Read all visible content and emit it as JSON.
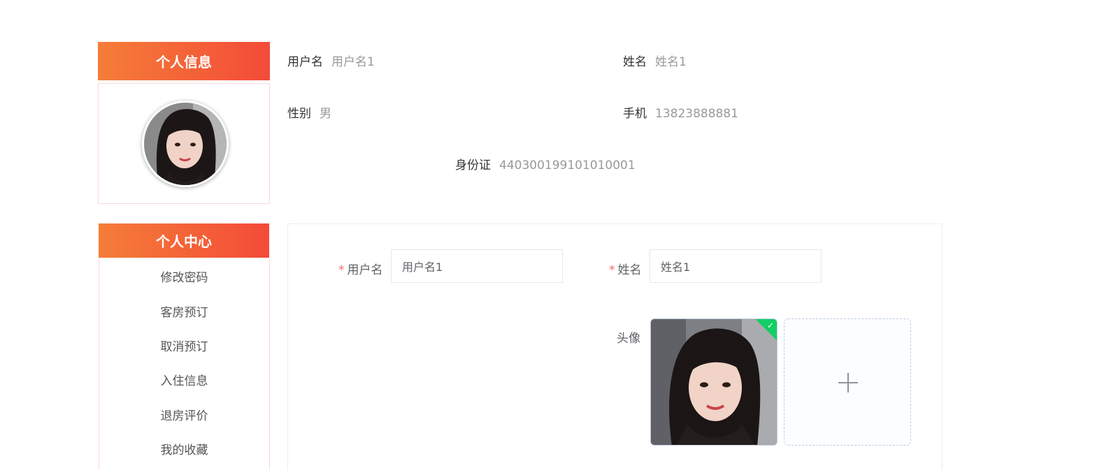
{
  "profile": {
    "header": "个人信息",
    "fields": {
      "username": {
        "label": "用户名",
        "value": "用户名1"
      },
      "name": {
        "label": "姓名",
        "value": "姓名1"
      },
      "gender": {
        "label": "性别",
        "value": "男"
      },
      "phone": {
        "label": "手机",
        "value": "13823888881"
      },
      "id_card": {
        "label": "身份证",
        "value": "440300199101010001"
      }
    }
  },
  "sidebar": {
    "header": "个人中心",
    "items": [
      {
        "label": "修改密码"
      },
      {
        "label": "客房预订"
      },
      {
        "label": "取消预订"
      },
      {
        "label": "入住信息"
      },
      {
        "label": "退房评价"
      },
      {
        "label": "我的收藏"
      }
    ]
  },
  "form": {
    "username": {
      "required_mark": "*",
      "label": "用户名",
      "value": "用户名1"
    },
    "name": {
      "required_mark": "*",
      "label": "姓名",
      "value": "姓名1"
    },
    "avatar": {
      "label": "头像",
      "upload_status": "success"
    }
  },
  "colors": {
    "header_gradient_start": "#f57d38",
    "header_gradient_end": "#f34b38",
    "success": "#13ce66",
    "required": "#f56c6c"
  },
  "icons": {
    "upload_success": "check-icon",
    "upload_add": "plus-icon"
  }
}
